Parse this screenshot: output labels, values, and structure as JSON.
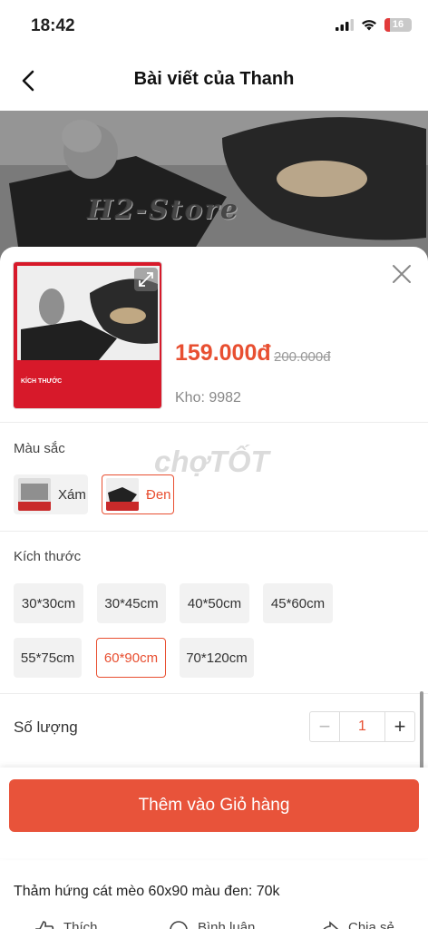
{
  "status_bar": {
    "time": "18:42",
    "battery": "16"
  },
  "nav": {
    "title": "Bài viết của Thanh"
  },
  "hero": {
    "watermark": "H2-Store"
  },
  "product": {
    "price": "159.000đ",
    "old_price": "200.000đ",
    "stock": "Kho: 9982",
    "thumb_label": "KÍCH THƯỚC"
  },
  "color": {
    "label": "Màu sắc",
    "options": [
      {
        "label": "Xám",
        "selected": false
      },
      {
        "label": "Đen",
        "selected": true
      }
    ]
  },
  "watermark": "chợTỐT",
  "size": {
    "label": "Kích thước",
    "options": [
      {
        "label": "30*30cm",
        "selected": false
      },
      {
        "label": "30*45cm",
        "selected": false
      },
      {
        "label": "40*50cm",
        "selected": false
      },
      {
        "label": "45*60cm",
        "selected": false
      },
      {
        "label": "55*75cm",
        "selected": false
      },
      {
        "label": "60*90cm",
        "selected": true
      },
      {
        "label": "70*120cm",
        "selected": false
      }
    ]
  },
  "quantity": {
    "label": "Số lượng",
    "value": "1",
    "minus": "−",
    "plus": "+"
  },
  "cart": {
    "button_label": "Thêm vào Giỏ hàng"
  },
  "post": {
    "text": "Thảm hứng cát mèo 60x90 màu đen: 70k"
  },
  "actions": [
    {
      "label": "Thích",
      "icon": "like-icon"
    },
    {
      "label": "Bình luận",
      "icon": "comment-icon"
    },
    {
      "label": "Chia sẻ",
      "icon": "share-icon"
    }
  ],
  "colors": {
    "accent": "#e84f31",
    "button": "#e8533a"
  }
}
